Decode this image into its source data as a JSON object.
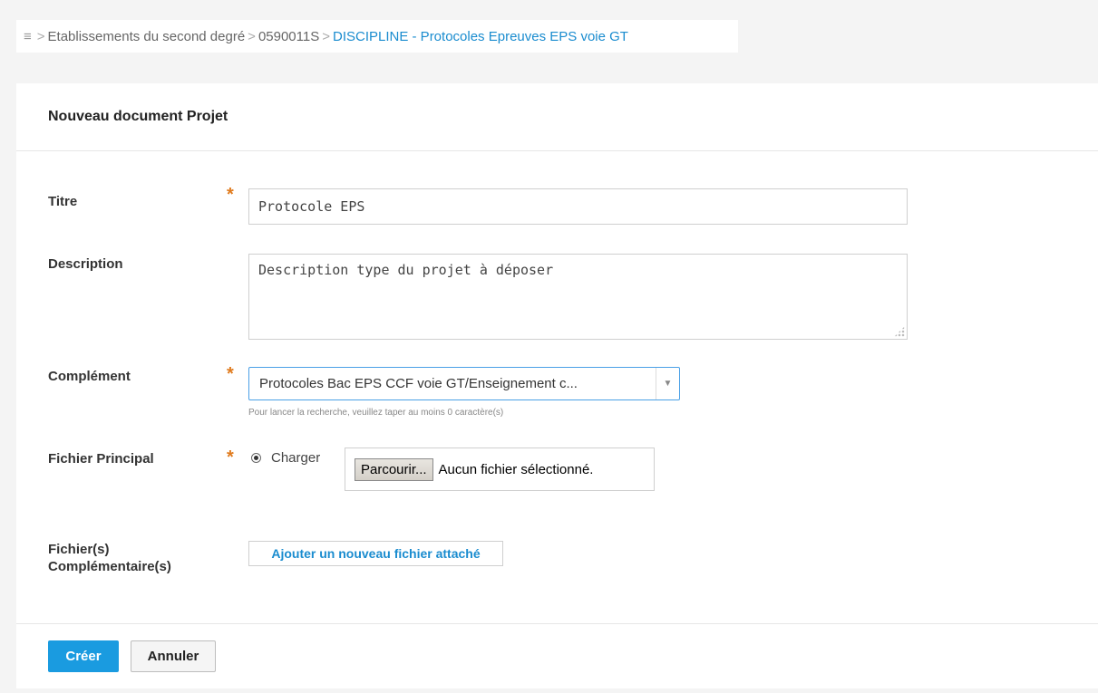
{
  "breadcrumb": {
    "menu_icon": "hamburger-icon",
    "items": [
      "Etablissements du second degré",
      "0590011S",
      "DISCIPLINE - Protocoles Epreuves EPS voie GT"
    ]
  },
  "panel": {
    "title": "Nouveau document Projet"
  },
  "form": {
    "titre": {
      "label": "Titre",
      "value": "Protocole EPS",
      "required": true
    },
    "description": {
      "label": "Description",
      "value": "Description type du projet à déposer"
    },
    "complement": {
      "label": "Complément",
      "value": "Protocoles Bac EPS CCF voie GT/Enseignement c...",
      "hint": "Pour lancer la recherche, veuillez taper au moins 0 caractère(s)",
      "required": true
    },
    "fichier_principal": {
      "label": "Fichier Principal",
      "radio_label": "Charger",
      "browse_label": "Parcourir...",
      "file_status": "Aucun fichier sélectionné.",
      "required": true
    },
    "fichiers_complementaires": {
      "label_line1": "Fichier(s)",
      "label_line2": "Complémentaire(s)",
      "button": "Ajouter un nouveau fichier attaché"
    }
  },
  "actions": {
    "create": "Créer",
    "cancel": "Annuler"
  },
  "colors": {
    "accent": "#1a9be0",
    "link": "#1a8ccf",
    "required_star": "#e07b1e"
  }
}
